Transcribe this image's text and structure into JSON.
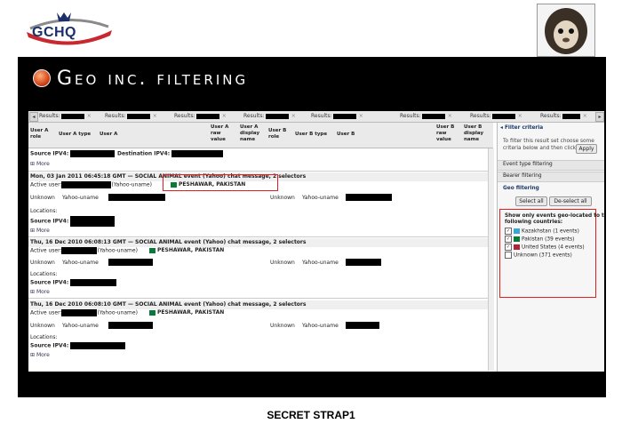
{
  "logo": {
    "text": "GCHQ"
  },
  "slide": {
    "title": "Geo inc. filtering"
  },
  "tabs": {
    "label": "Results:",
    "close": "×"
  },
  "table": {
    "headers": {
      "user_a_role": "User A role",
      "user_a_type": "User A type",
      "user_a": "User A",
      "user_a_raw": "User A raw value",
      "user_a_display": "User A display name",
      "user_b_role": "User B role",
      "user_b_type": "User B type",
      "user_b": "User B",
      "user_b_raw": "User B raw value",
      "user_b_display": "User B display name"
    },
    "top": {
      "source": "Source IPV4:",
      "destination": "Destination IPV4:",
      "more": "More"
    },
    "events": [
      {
        "header": "Mon, 03 Jan 2011 06:45:18 GMT — SOCIAL ANIMAL event (Yahoo) chat message, 2 selectors",
        "active": "Active user:",
        "atype": "(Yahoo-uname)",
        "location": "PESHAWAR, PAKISTAN",
        "role_a": "Unknown",
        "type_a": "Yahoo-uname",
        "role_b": "Unknown",
        "type_b": "Yahoo-uname",
        "locations": "Locations:",
        "source": "Source IPV4:",
        "more": "More"
      },
      {
        "header": "Thu, 16 Dec 2010 06:08:13 GMT — SOCIAL ANIMAL event (Yahoo) chat message, 2 selectors",
        "active": "Active user:",
        "atype": "(Yahoo-uname)",
        "location": "PESHAWAR, PAKISTAN",
        "role_a": "Unknown",
        "type_a": "Yahoo-uname",
        "role_b": "Unknown",
        "type_b": "Yahoo-uname",
        "locations": "Locations:",
        "source": "Source IPV4:",
        "more": "More"
      },
      {
        "header": "Thu, 16 Dec 2010 06:08:10 GMT — SOCIAL ANIMAL event (Yahoo) chat message, 2 selectors",
        "active": "Active user:",
        "atype": "(Yahoo-uname)",
        "location": "PESHAWAR, PAKISTAN",
        "role_a": "Unknown",
        "type_a": "Yahoo-uname",
        "role_b": "Unknown",
        "type_b": "Yahoo-uname",
        "locations": "Locations:",
        "source": "Source IPV4:",
        "more": "More"
      }
    ]
  },
  "sidebar": {
    "title": "Filter criteria",
    "help_1": "To filter this result set choose some",
    "help_2": "criteria below and then click",
    "apply": "Apply",
    "event_type": "Event type filtering",
    "bearer": "Bearer filtering",
    "geo": "Geo filtering",
    "select_all": "Select all",
    "deselect_all": "De-select all",
    "geo_heading_1": "Show only events geo-located to the",
    "geo_heading_2": "following countries:",
    "countries": [
      {
        "name": "Kazakhstan (1 events)",
        "checked": true,
        "flag": "#3aa6d8"
      },
      {
        "name": "Pakistan (39 events)",
        "checked": true,
        "flag": "#0a7a3a"
      },
      {
        "name": "United States (4 events)",
        "checked": true,
        "flag": "#b22234"
      },
      {
        "name": "Unknown (371 events)",
        "checked": false,
        "flag": ""
      }
    ]
  },
  "footer": {
    "classification": "SECRET STRAP1"
  },
  "colors": {
    "highlight": "#e02020",
    "slide_bg": "#000000"
  }
}
